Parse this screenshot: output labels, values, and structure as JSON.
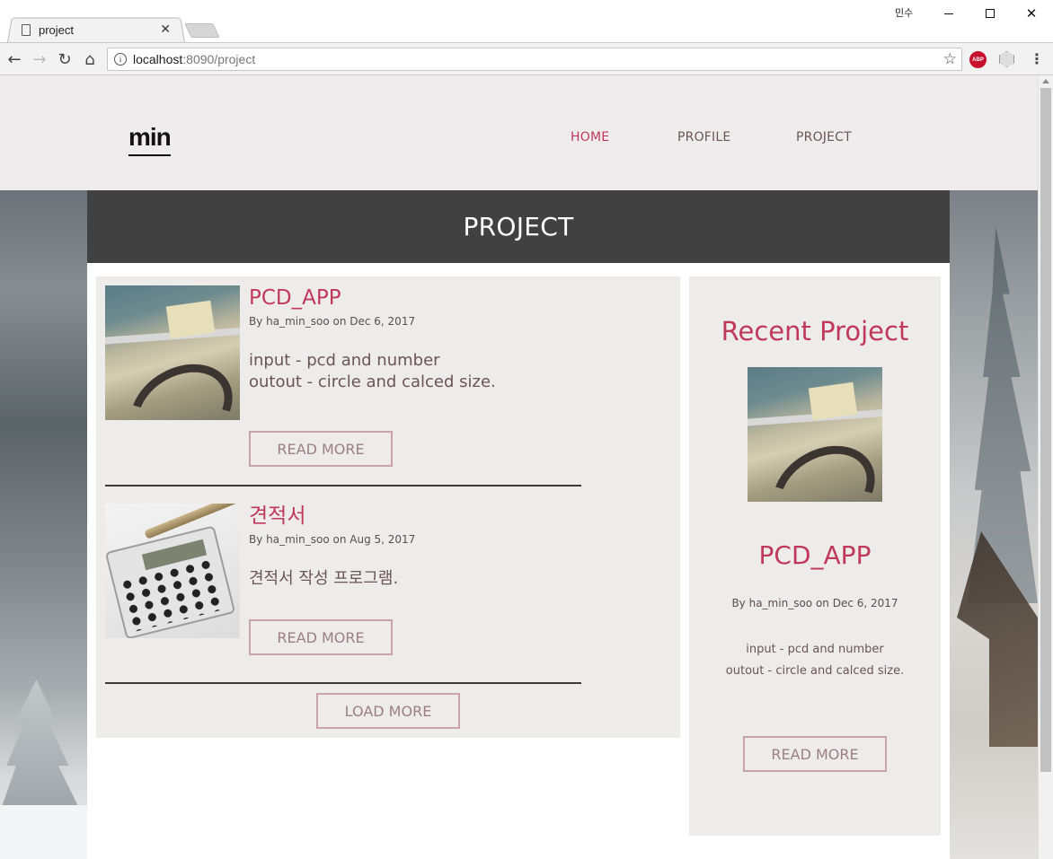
{
  "browser": {
    "tab_title": "project",
    "tab_close": "✕",
    "user_name": "민수",
    "url_host": "localhost",
    "url_rest": ":8090/project",
    "extension_abp": "ABP"
  },
  "header": {
    "logo": "min",
    "nav": [
      {
        "label": "HOME",
        "active": true
      },
      {
        "label": "PROFILE",
        "active": false
      },
      {
        "label": "PROJECT",
        "active": false
      }
    ]
  },
  "page": {
    "banner_title": "PROJECT"
  },
  "posts": [
    {
      "title": "PCD_APP",
      "meta": "By ha_min_soo on Dec 6, 2017",
      "excerpt_lines": [
        "input - pcd and number",
        "outout - circle and calced size."
      ],
      "read_more": "READ MORE",
      "thumbnail": "map-drafting-thumbnail"
    },
    {
      "title": "견적서",
      "meta": "By ha_min_soo on Aug 5, 2017",
      "excerpt_lines": [
        "견적서 작성 프로그램."
      ],
      "read_more": "READ MORE",
      "thumbnail": "calculator-thumbnail"
    }
  ],
  "load_more": "LOAD MORE",
  "sidebar": {
    "title": "Recent Project",
    "post_title": "PCD_APP",
    "meta": "By ha_min_soo on Dec 6, 2017",
    "excerpt_lines": [
      "input - pcd and number",
      "outout - circle and calced size."
    ],
    "read_more": "READ MORE"
  },
  "colors": {
    "accent": "#c0395a",
    "banner_bg": "#424141",
    "panel_bg": "#eeebeb",
    "button_border": "#c8a3a8"
  }
}
